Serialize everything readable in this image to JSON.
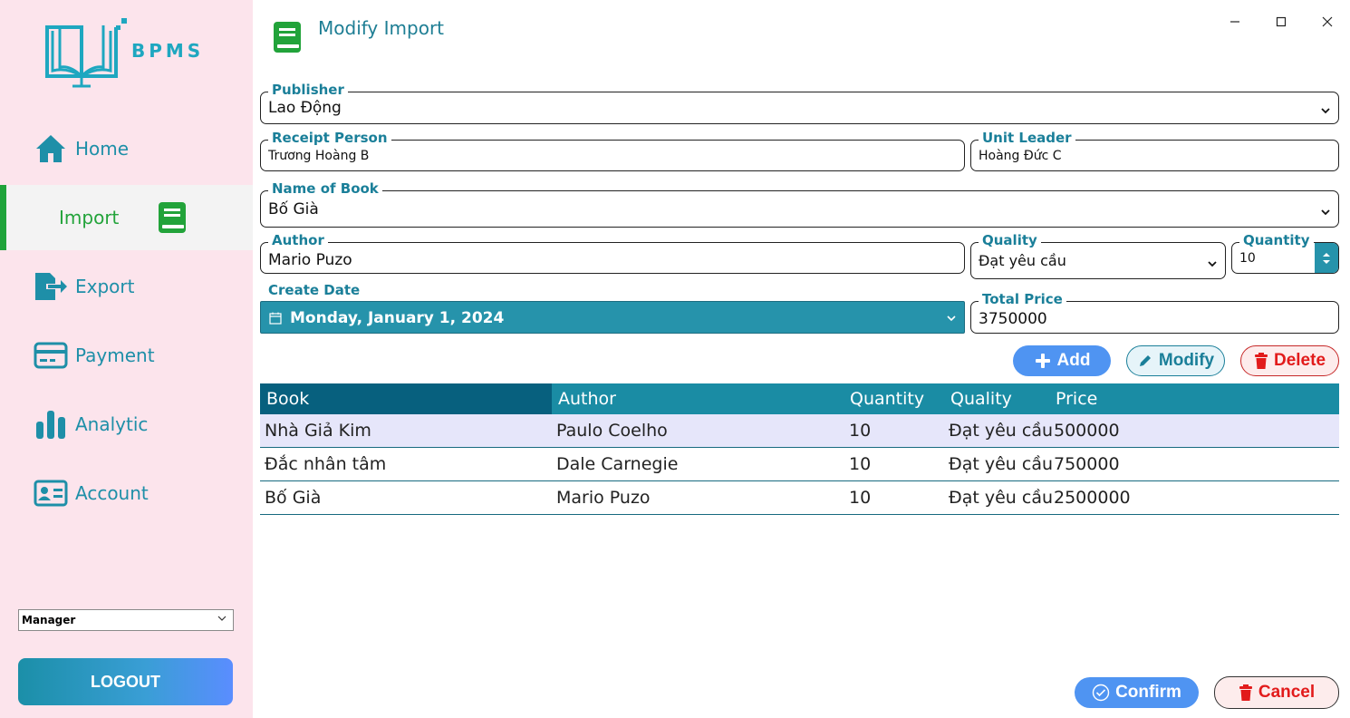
{
  "app": {
    "logo_text": "BPMS",
    "window_title": "Modify Import"
  },
  "sidebar": {
    "items": [
      {
        "label": "Home",
        "icon": "home-icon"
      },
      {
        "label": "Import",
        "icon": "book-icon"
      },
      {
        "label": "Export",
        "icon": "export-icon"
      },
      {
        "label": "Payment",
        "icon": "card-icon"
      },
      {
        "label": "Analytic",
        "icon": "bar-chart-icon"
      },
      {
        "label": "Account",
        "icon": "id-card-icon"
      }
    ],
    "active": "Import",
    "role": "Manager",
    "logout_label": "LOGOUT"
  },
  "form": {
    "publisher": {
      "label": "Publisher",
      "value": "Lao Động"
    },
    "receipt_person": {
      "label": "Receipt Person",
      "value": "Trương Hoàng B"
    },
    "unit_leader": {
      "label": "Unit Leader",
      "value": "Hoàng Đức C"
    },
    "book_name": {
      "label": "Name of Book",
      "value": "Bố Già"
    },
    "author": {
      "label": "Author",
      "value": "Mario Puzo"
    },
    "quality": {
      "label": "Quality",
      "value": "Đạt yêu cầu"
    },
    "quantity": {
      "label": "Quantity",
      "value": "10"
    },
    "create_date": {
      "label": "Create Date",
      "value": "Monday, January 1, 2024"
    },
    "total_price": {
      "label": "Total Price",
      "value": "3750000"
    }
  },
  "actions": {
    "add": "Add",
    "modify": "Modify",
    "delete": "Delete",
    "confirm": "Confirm",
    "cancel": "Cancel"
  },
  "table": {
    "columns": [
      "Book",
      "Author",
      "Quantity",
      "Quality",
      "Price"
    ],
    "rows": [
      {
        "book": "Nhà Giả Kim",
        "author": "Paulo Coelho",
        "quantity": "10",
        "quality": "Đạt yêu cầu",
        "price": "500000"
      },
      {
        "book": "Đắc nhân tâm",
        "author": "Dale Carnegie",
        "quantity": "10",
        "quality": "Đạt yêu cầu",
        "price": "750000"
      },
      {
        "book": "Bố Già",
        "author": "Mario Puzo",
        "quantity": "10",
        "quality": "Đạt yêu cầu",
        "price": "2500000"
      }
    ]
  },
  "colors": {
    "accent": "#1a8ca4",
    "active_green": "#22a33a",
    "sidebar_bg": "#fce4ec",
    "delete_red": "#e21b1b",
    "add_blue": "#4f94f2"
  }
}
